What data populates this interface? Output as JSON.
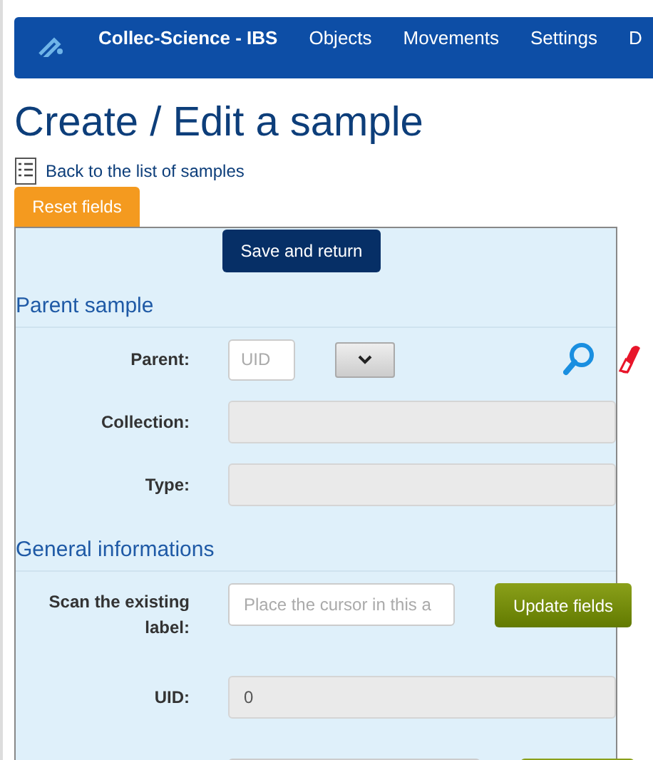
{
  "navbar": {
    "brand": "Collec-Science - IBS",
    "items": [
      "Objects",
      "Movements",
      "Settings",
      "D"
    ]
  },
  "page_title": "Create / Edit a sample",
  "back_link": "Back to the list of samples",
  "reset_button": "Reset fields",
  "save_button": "Save and return",
  "sections": [
    {
      "title": "Parent sample",
      "rows": [
        {
          "kind": "parent",
          "label": "Parent:",
          "placeholder": "UID"
        },
        {
          "kind": "readonly",
          "label": "Collection:"
        },
        {
          "kind": "readonly",
          "label": "Type:"
        }
      ]
    },
    {
      "title": "General informations",
      "rows": [
        {
          "kind": "scan",
          "label": "Scan the existing label:",
          "placeholder": "Place the cursor in this a",
          "button": "Update fields"
        },
        {
          "kind": "readonly",
          "label": "UID:",
          "value": "0"
        },
        {
          "kind": "partial"
        }
      ]
    }
  ]
}
